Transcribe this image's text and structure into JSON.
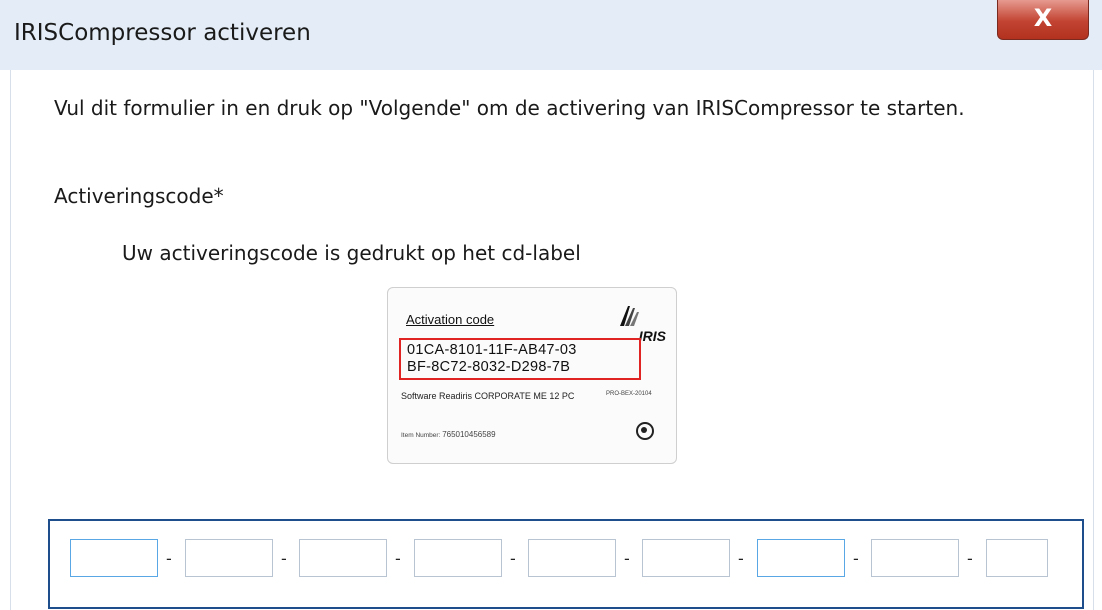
{
  "window": {
    "title": "IRISCompressor activeren",
    "close_label": "X"
  },
  "instruction": "Vul dit formulier in en druk op \"Volgende\" om de activering van IRISCompressor te starten.",
  "activation_label": "Activeringscode*",
  "hint": "Uw activeringscode is gedrukt op het cd-label",
  "card": {
    "title": "Activation code",
    "logo_text": "IRIS",
    "code_line1": "01CA-8101-11F-AB47-03",
    "code_line2": "BF-8C72-8032-D298-7B",
    "software": "Software Readiris CORPORATE ME 12 PC",
    "product_code": "PRO-BEX-20104",
    "item_label": "Item Number:",
    "item_number": "765010456589"
  },
  "entry": {
    "separator": "-",
    "segments": [
      "",
      "",
      "",
      "",
      "",
      "",
      "",
      "",
      ""
    ]
  },
  "colors": {
    "titlebar": "#e4edf7",
    "close": "#c24331",
    "entry_border": "#1f4e8c",
    "highlight": "#e02424"
  }
}
